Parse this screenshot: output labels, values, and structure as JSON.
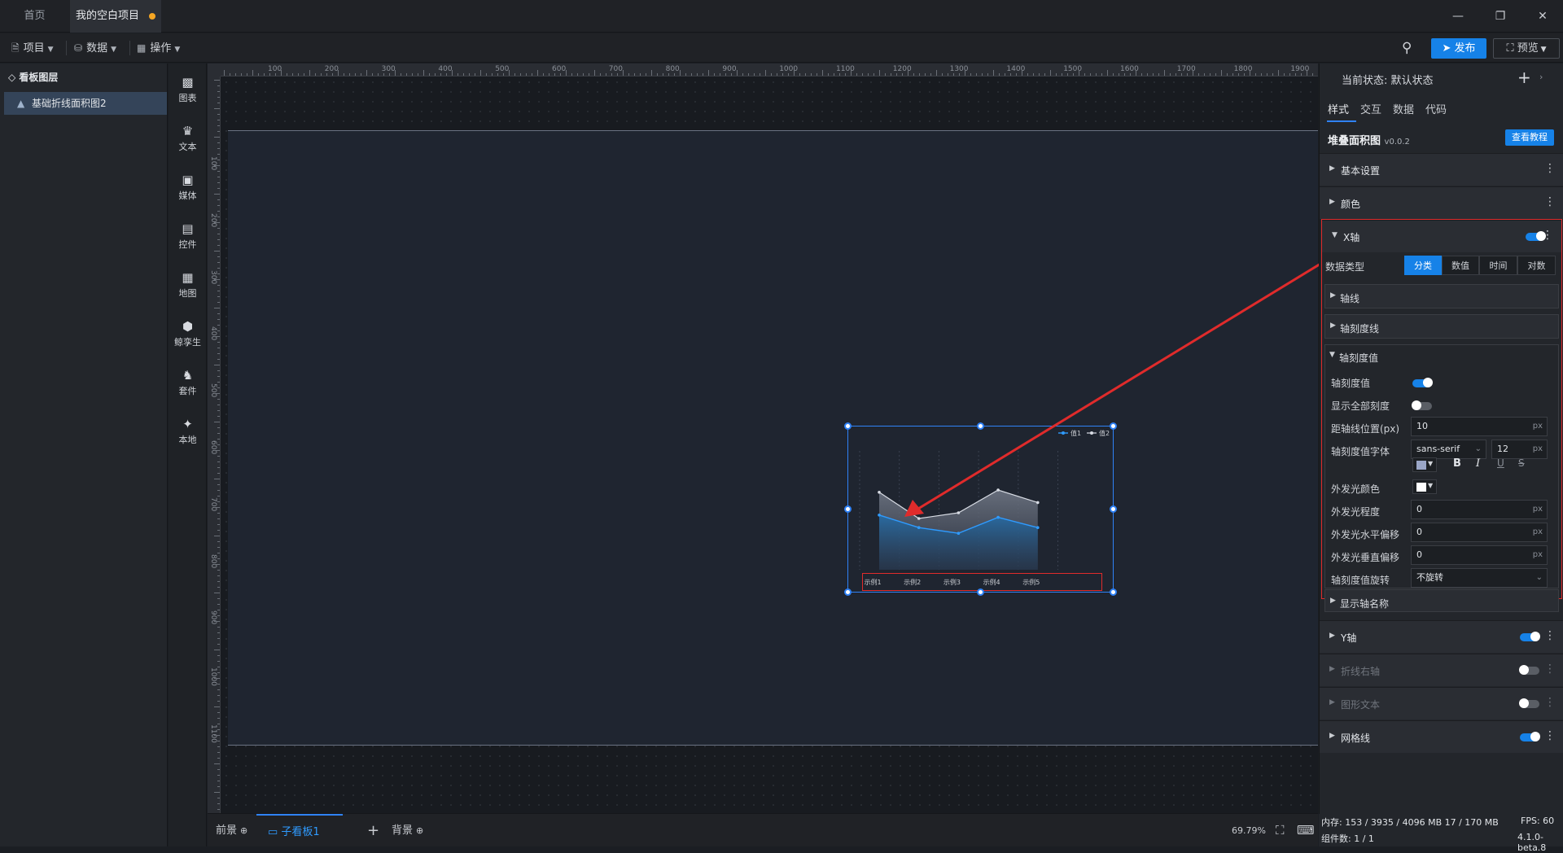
{
  "tabs": [
    {
      "label": "首页"
    },
    {
      "label": "我的空白项目"
    }
  ],
  "toolbar": {
    "project": "项目",
    "data": "数据",
    "ops": "操作",
    "publish": "发布",
    "preview": "预览"
  },
  "layers": {
    "title": "看板图层",
    "item": "基础折线面积图2"
  },
  "components": [
    "图表",
    "文本",
    "媒体",
    "控件",
    "地图",
    "鲸孪生",
    "套件",
    "本地"
  ],
  "ruler": {
    "top": [
      "100",
      "200",
      "300",
      "400",
      "500",
      "600",
      "700",
      "800",
      "900",
      "1000",
      "1100",
      "1200",
      "1300",
      "1400",
      "1500",
      "1600",
      "1700",
      "1800",
      "1900"
    ],
    "left": [
      "100",
      "200",
      "300",
      "400",
      "500",
      "600",
      "700",
      "800",
      "900",
      "1000",
      "1100"
    ]
  },
  "chart": {
    "legend": [
      "值1",
      "值2"
    ],
    "x_labels": [
      "示例1",
      "示例2",
      "示例3",
      "示例4",
      "示例5"
    ],
    "series_top": [
      68,
      45,
      50,
      70,
      59
    ],
    "series_bottom": [
      48,
      37,
      32,
      46,
      37
    ],
    "y_max": 100
  },
  "bottom": {
    "front": "前景",
    "sub": "子看板1",
    "back": "背景",
    "zoom": "69.79%"
  },
  "panel": {
    "state_label": "当前状态:",
    "state_value": "默认状态",
    "tabs": [
      "样式",
      "交互",
      "数据",
      "代码"
    ],
    "component_name": "堆叠面积图",
    "version": "v0.0.2",
    "tutorial": "查看教程",
    "sections": {
      "basic": "基本设置",
      "color": "颜色",
      "xaxis": "X轴",
      "yaxis": "Y轴",
      "right_axis": "折线右轴",
      "shape_text": "图形文本",
      "grid": "网格线"
    },
    "data_type_label": "数据类型",
    "data_types": [
      "分类",
      "数值",
      "时间",
      "对数"
    ],
    "sub": {
      "axis_line": "轴线",
      "tick_line": "轴刻度线",
      "tick_value": "轴刻度值",
      "show_name": "显示轴名称"
    },
    "fields": {
      "tick_value": "轴刻度值",
      "show_all": "显示全部刻度",
      "offset": "距轴线位置(px)",
      "offset_val": "10",
      "font": "轴刻度值字体",
      "font_val": "sans-serif",
      "font_size": "12",
      "glow_color": "外发光颜色",
      "glow_level": "外发光程度",
      "glow_level_val": "0",
      "glow_h": "外发光水平偏移",
      "glow_h_val": "0",
      "glow_v": "外发光垂直偏移",
      "glow_v_val": "0",
      "rotate": "轴刻度值旋转",
      "rotate_val": "不旋转",
      "unit": "px"
    },
    "colors": {
      "accent": "#1682e8",
      "highlight": "#e02b2b"
    }
  },
  "status": {
    "memory": "内存: 153 / 3935 / 4096 MB 17 / 170 MB",
    "fps": "FPS: 60",
    "count": "组件数: 1 / 1",
    "version": "4.1.0-beta.8"
  }
}
